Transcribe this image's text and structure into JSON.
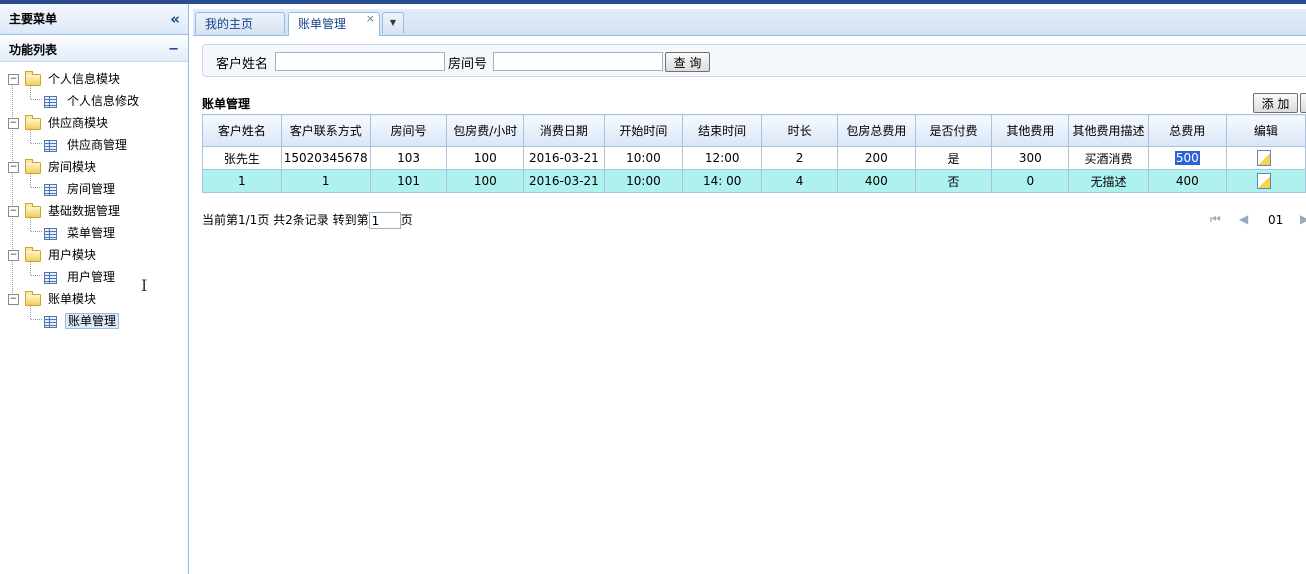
{
  "sidebar": {
    "title": "主要菜单",
    "collapse_icon": "«",
    "section_title": "功能列表",
    "section_toggle": "−",
    "tree": [
      {
        "label": "个人信息模块",
        "child": "个人信息修改"
      },
      {
        "label": "供应商模块",
        "child": "供应商管理"
      },
      {
        "label": "房间模块",
        "child": "房间管理"
      },
      {
        "label": "基础数据管理",
        "child": "菜单管理"
      },
      {
        "label": "用户模块",
        "child": "用户管理"
      },
      {
        "label": "账单模块",
        "child": "账单管理"
      }
    ],
    "toggle_symbol": "−"
  },
  "tabs": {
    "home": "我的主页",
    "active": "账单管理",
    "close": "×",
    "menu": "▼"
  },
  "search": {
    "name_label": "客户姓名",
    "room_label": "房间号",
    "name_value": "",
    "room_value": "",
    "button": "查 询"
  },
  "grid": {
    "title": "账单管理",
    "add_button": "添 加",
    "columns": [
      "客户姓名",
      "客户联系方式",
      "房间号",
      "包房费/小时",
      "消费日期",
      "开始时间",
      "结束时间",
      "时长",
      "包房总费用",
      "是否付费",
      "其他费用",
      "其他费用描述",
      "总费用",
      "编辑"
    ],
    "rows": [
      [
        "张先生",
        "15020345678",
        "103",
        "100",
        "2016-03-21",
        "10:00",
        "12:00",
        "2",
        "200",
        "是",
        "300",
        "买酒消费",
        "500"
      ],
      [
        "1",
        "1",
        "101",
        "100",
        "2016-03-21",
        "10:00",
        "14: 00",
        "4",
        "400",
        "否",
        "0",
        "无描述",
        "400"
      ]
    ]
  },
  "pager": {
    "prefix": "当前第1/1页 共2条记录 转到第",
    "page_input": "1",
    "suffix": "页",
    "current": "01",
    "first_icon": "⏮",
    "prev_icon": "◀",
    "next_icon": "▶"
  },
  "colors": {
    "accent": "#2a4d8f",
    "border": "#99bbe8",
    "selected_row": "#aef1ee"
  }
}
